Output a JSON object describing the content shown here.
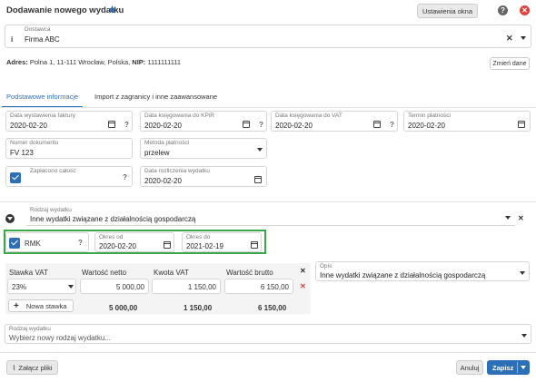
{
  "header": {
    "title": "Dodawanie nowego wydatku",
    "settings_label": "Ustawienia okna"
  },
  "supplier": {
    "label": "Dostawca",
    "value": "Firma ABC"
  },
  "address": {
    "prefix": "Adres:",
    "text": "Polna 1, 11-111 Wrocław, Polska,",
    "nip_label": "NIP:",
    "nip_value": "1111111111",
    "change_label": "Zmień dane"
  },
  "tabs": [
    {
      "label": "Podstawowe informacje",
      "active": true
    },
    {
      "label": "Import z zagranicy i inne zaawansowane",
      "active": false
    }
  ],
  "dates": {
    "issue": {
      "label": "Data wystawienia faktury",
      "value": "2020-02-20"
    },
    "kpir": {
      "label": "Data księgowania do KPiR",
      "value": "2020-02-20"
    },
    "vat": {
      "label": "Data księgowania do VAT",
      "value": "2020-02-20"
    },
    "due": {
      "label": "Termin płatności",
      "value": "2020-02-20"
    },
    "settlement": {
      "label": "Data rozliczenia wydatku",
      "value": "2020-02-20"
    }
  },
  "document": {
    "label": "Numer dokumentu",
    "value": "FV 123"
  },
  "payment": {
    "label": "Metoda płatności",
    "value": "przelew"
  },
  "paid": {
    "label": "Zapłacono całość"
  },
  "expense_type": {
    "label": "Rodzaj wydatku",
    "value": "Inne wydatki związane z działalnością gospodarczą"
  },
  "rmk": {
    "label": "RMK",
    "from_label": "Okres od",
    "from_value": "2020-02-20",
    "to_label": "Okres do",
    "to_value": "2021-02-19"
  },
  "vat_table": {
    "headers": [
      "Stawka VAT",
      "Wartość netto",
      "Kwota VAT",
      "Wartość brutto"
    ],
    "row": {
      "rate": "23%",
      "net": "5 000,00",
      "vat": "1 150,00",
      "gross": "6 150,00"
    },
    "add_label": "Nowa stawka",
    "totals": {
      "net": "5 000,00",
      "vat": "1 150,00",
      "gross": "6 150,00"
    }
  },
  "description": {
    "label": "Opis",
    "value": "Inne wydatki związane z działalnością gospodarczą"
  },
  "new_expense_type": {
    "label": "Rodzaj wydatku",
    "placeholder": "Wybierz nowy rodzaj wydatku..."
  },
  "footer": {
    "attach_label": "Załącz pliki",
    "cancel_label": "Anuluj",
    "save_label": "Zapisz"
  },
  "colors": {
    "accent": "#2d6fb7",
    "highlight_border": "#3aa84a",
    "close_red": "#e0403a"
  }
}
